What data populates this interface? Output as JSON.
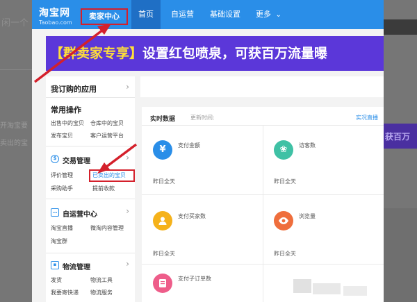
{
  "backdrop": {
    "big_text": "闲一个",
    "side_text_1": "开淘宝要",
    "side_text_2": "卖出的宝",
    "right_banner": "获百万"
  },
  "topnav": {
    "logo_main": "淘宝网",
    "logo_sub": "Taobao.com",
    "seller_center": "卖家中心",
    "items": [
      "首页",
      "自运营",
      "基础设置",
      "更多"
    ],
    "more_chevron": "⌄"
  },
  "banner": {
    "highlight": "【群卖家专享】",
    "text": "设置红包喷泉，可获百万流量曝"
  },
  "sidebar": {
    "my_apps": "我订购的应用",
    "common_ops": "常用操作",
    "common_links": [
      "出售中的宝贝",
      "仓库中的宝贝",
      "发布宝贝",
      "客户运营平台"
    ],
    "trade_title": "交易管理",
    "trade_links": [
      "评价管理",
      "已卖出的宝贝",
      "采购助手",
      "提前收款"
    ],
    "selfop_title": "自运营中心",
    "selfop_links": [
      "淘宝直播",
      "微淘内容管理",
      "淘宝群"
    ],
    "logistics_title": "物流管理",
    "logistics_links": [
      "发货",
      "物流工具",
      "我要寄快递",
      "物流服务"
    ],
    "chevron": "›"
  },
  "realtime": {
    "title": "实时数据",
    "update_label": "更新时间:",
    "live_link": "实况直播",
    "metrics": [
      {
        "label": "支付金额",
        "sub": "昨日全天",
        "icon": "yen-icon",
        "color": "#2a8ee8",
        "glyph": "¥"
      },
      {
        "label": "访客数",
        "sub": "昨日全天",
        "icon": "paw-icon",
        "color": "#3fc1a5",
        "glyph": "❀"
      },
      {
        "label": "支付买家数",
        "sub": "昨日全天",
        "icon": "buyer-icon",
        "color": "#f5b21b",
        "glyph": "👤"
      },
      {
        "label": "浏览量",
        "sub": "昨日全天",
        "icon": "eye-icon",
        "color": "#ef6e3c",
        "glyph": "◉"
      },
      {
        "label": "支付子订单数",
        "sub": "",
        "icon": "order-icon",
        "color": "#ee5d8a",
        "glyph": "▤"
      }
    ]
  },
  "colors": {
    "nav": "#2a8ee8",
    "annotation_red": "#d4202b",
    "banner_purple": "#5b37d9"
  }
}
